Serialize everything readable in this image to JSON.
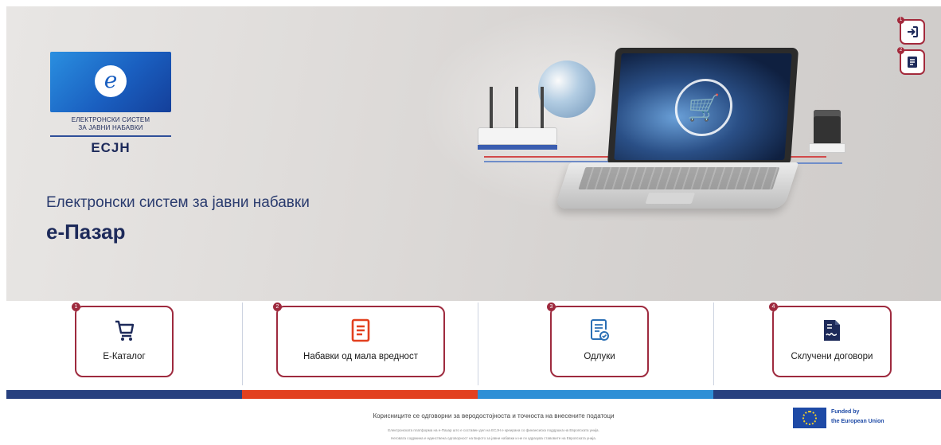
{
  "logo": {
    "mark": "e",
    "line1": "ЕЛЕКТРОНСКИ СИСТЕМ",
    "line2": "ЗА ЈАВНИ НАБАВКИ",
    "abbr": "ЕСЈН"
  },
  "hero": {
    "subtitle": "Електронски систем за јавни набавки",
    "title": "е-Пазар"
  },
  "corner_buttons": [
    {
      "num": "1",
      "icon": "login-icon"
    },
    {
      "num": "2",
      "icon": "document-icon"
    }
  ],
  "cards": [
    {
      "num": "1",
      "label": "Е-Каталог",
      "icon": "cart-icon"
    },
    {
      "num": "2",
      "label": "Набавки од мала вредност",
      "icon": "list-document-icon"
    },
    {
      "num": "3",
      "label": "Одлуки",
      "icon": "approved-document-icon"
    },
    {
      "num": "4",
      "label": "Склучени договори",
      "icon": "signed-contract-icon"
    }
  ],
  "colors": {
    "brand_dark": "#1d2a5a",
    "card_border": "#9e2a3e",
    "bar_navy": "#27407f",
    "bar_red": "#e2401f",
    "bar_blue": "#2e8fd6",
    "bar_navy2": "#27407f"
  },
  "footer": {
    "disclaimer": "Корисниците се одговорни за веродостојноста и точноста на внесените податоци",
    "fine1": "Електронската платформа на е-Пазар што е составен дел на ЕСЈН е креирана со финансиска поддршка на Европската унија.",
    "fine2": "Неговата содржина е единствена одговорност на Бирото за јавни набавки и не ги одразува ставовите на Европската унија.",
    "eu_line1": "Funded by",
    "eu_line2": "the European Union"
  }
}
